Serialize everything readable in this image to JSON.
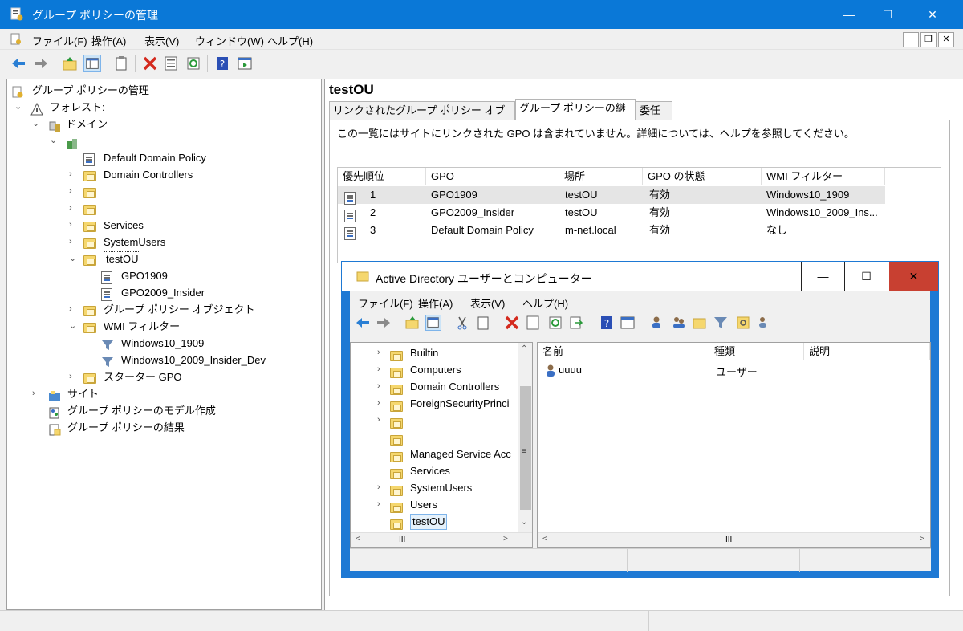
{
  "window": {
    "title": "グループ ポリシーの管理",
    "controls": {
      "minimize": "—",
      "maximize": "☐",
      "close": "✕"
    }
  },
  "menu": [
    "ファイル(F)",
    "操作(A)",
    "表示(V)",
    "ウィンドウ(W)",
    "ヘルプ(H)"
  ],
  "tree": {
    "root": "グループ ポリシーの管理",
    "forest": "フォレスト:",
    "domains": "ドメイン",
    "domain_name": "",
    "items": [
      "Default Domain Policy",
      "Domain Controllers",
      "",
      "",
      "Services",
      "SystemUsers",
      "testOU"
    ],
    "testou_children": [
      "GPO1909",
      "GPO2009_Insider"
    ],
    "gpo_objects": "グループ ポリシー オブジェクト",
    "wmi_filters": "WMI フィルター",
    "wmi_children": [
      "Windows10_1909",
      "Windows10_2009_Insider_Dev"
    ],
    "starter_gpo": "スターター GPO",
    "sites": "サイト",
    "modeling": "グループ ポリシーのモデル作成",
    "results": "グループ ポリシーの結果"
  },
  "right": {
    "title": "testOU",
    "tabs": [
      "リンクされたグループ ポリシー オブジェクト",
      "グループ ポリシーの継承",
      "委任"
    ],
    "active_tab": "グループ ポリシーの継承",
    "info": "この一覧にはサイトにリンクされた GPO は含まれていません。詳細については、ヘルプを参照してください。",
    "columns": [
      "優先順位",
      "GPO",
      "場所",
      "GPO の状態",
      "WMI フィルター"
    ],
    "rows": [
      {
        "priority": "1",
        "gpo": "GPO1909",
        "location": "testOU",
        "status": "有効",
        "wmi": "Windows10_1909"
      },
      {
        "priority": "2",
        "gpo": "GPO2009_Insider",
        "location": "testOU",
        "status": "有効",
        "wmi": "Windows10_2009_Ins..."
      },
      {
        "priority": "3",
        "gpo": "Default Domain Policy",
        "location": "m-net.local",
        "status": "有効",
        "wmi": "なし"
      }
    ]
  },
  "aduc": {
    "title": "Active Directory ユーザーとコンピューター",
    "menu": [
      "ファイル(F)",
      "操作(A)",
      "表示(V)",
      "ヘルプ(H)"
    ],
    "tree_items": [
      "Builtin",
      "Computers",
      "Domain Controllers",
      "ForeignSecurityPrinci",
      "",
      "",
      "Managed Service Acc",
      "Services",
      "SystemUsers",
      "Users",
      "testOU"
    ],
    "columns": [
      "名前",
      "種類",
      "説明"
    ],
    "rows": [
      {
        "name": "uuuu",
        "type": "ユーザー",
        "desc": ""
      }
    ],
    "scroll_h": "III"
  },
  "colors": {
    "titlebar": "#0a78d7",
    "aduc_border": "#1e79d4",
    "close_red": "#c84031",
    "folder": "#f5d76e"
  }
}
